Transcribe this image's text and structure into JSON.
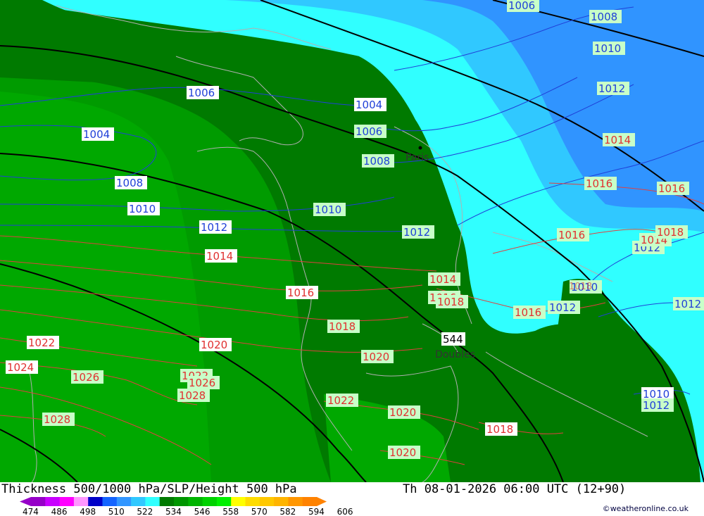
{
  "map": {
    "city_labels": [
      {
        "id": "paris",
        "text": "Paris"
      },
      {
        "id": "doubles",
        "text": "Doubles"
      }
    ],
    "isobars_blue": [
      "1006",
      "1004",
      "1004",
      "1006",
      "1008",
      "1008",
      "1010",
      "1010",
      "1012",
      "1012",
      "1012",
      "1006",
      "1008",
      "1010",
      "1012",
      "1010",
      "1012",
      "1012",
      "1010",
      "1012"
    ],
    "isobars_red": [
      "1014",
      "1016",
      "1018",
      "1020",
      "1022",
      "1024",
      "1026",
      "1028",
      "1014",
      "1016",
      "1018",
      "1020",
      "1022",
      "1020",
      "1020",
      "1018",
      "1016",
      "1016",
      "1014",
      "1014",
      "1016",
      "1016",
      "1018",
      "1018",
      "1022",
      "1026",
      "1028"
    ],
    "height_label": "544",
    "colors": {
      "dark_green": "#007a00",
      "mid_green": "#009b00",
      "light_green": "#00b400",
      "cyan": "#30ffff",
      "light_blue": "#30c8ff",
      "blue": "#3094ff"
    }
  },
  "footer": {
    "title": "Thickness 500/1000 hPa/SLP/Height 500 hPa",
    "valid_time": "Th 08-01-2026 06:00 UTC (12+90)",
    "credit": "©weatheronline.co.uk",
    "scale_labels": [
      "474",
      "486",
      "498",
      "510",
      "522",
      "534",
      "546",
      "558",
      "570",
      "582",
      "594",
      "606"
    ],
    "scale_colors": [
      "#9600c8",
      "#c800ff",
      "#ff00ff",
      "#ff96ff",
      "#0000c8",
      "#1464ff",
      "#3296ff",
      "#30c8ff",
      "#30ffff",
      "#007a00",
      "#009600",
      "#00b400",
      "#00d200",
      "#00f000",
      "#ffff00",
      "#ffdc00",
      "#ffc800",
      "#ffb400",
      "#ff9600",
      "#ff8200"
    ]
  }
}
